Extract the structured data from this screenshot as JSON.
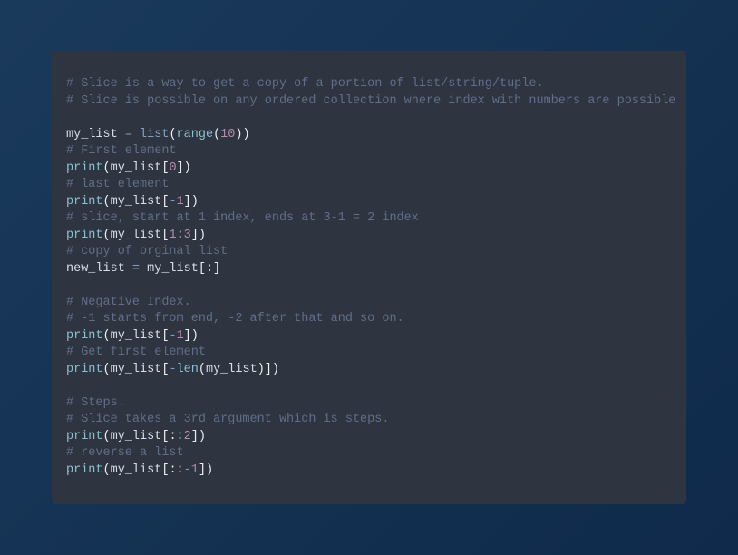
{
  "code": {
    "tokens": [
      [
        {
          "c": "comment",
          "t": "# Slice is a way to get a copy of a portion of list/string/tuple."
        }
      ],
      [
        {
          "c": "comment",
          "t": "# Slice is possible on any ordered collection where index with numbers are possible"
        }
      ],
      [],
      [
        {
          "c": "ident",
          "t": "my_list "
        },
        {
          "c": "operator",
          "t": "="
        },
        {
          "c": "ident",
          "t": " "
        },
        {
          "c": "builtin",
          "t": "list"
        },
        {
          "c": "punct",
          "t": "("
        },
        {
          "c": "func",
          "t": "range"
        },
        {
          "c": "punct",
          "t": "("
        },
        {
          "c": "number",
          "t": "10"
        },
        {
          "c": "punct",
          "t": "))"
        }
      ],
      [
        {
          "c": "comment",
          "t": "# First element"
        }
      ],
      [
        {
          "c": "func",
          "t": "print"
        },
        {
          "c": "punct",
          "t": "("
        },
        {
          "c": "ident",
          "t": "my_list"
        },
        {
          "c": "punct",
          "t": "["
        },
        {
          "c": "number",
          "t": "0"
        },
        {
          "c": "punct",
          "t": "])"
        }
      ],
      [
        {
          "c": "comment",
          "t": "# last element"
        }
      ],
      [
        {
          "c": "func",
          "t": "print"
        },
        {
          "c": "punct",
          "t": "("
        },
        {
          "c": "ident",
          "t": "my_list"
        },
        {
          "c": "punct",
          "t": "["
        },
        {
          "c": "operator",
          "t": "-"
        },
        {
          "c": "number",
          "t": "1"
        },
        {
          "c": "punct",
          "t": "])"
        }
      ],
      [
        {
          "c": "comment",
          "t": "# slice, start at 1 index, ends at 3-1 = 2 index"
        }
      ],
      [
        {
          "c": "func",
          "t": "print"
        },
        {
          "c": "punct",
          "t": "("
        },
        {
          "c": "ident",
          "t": "my_list"
        },
        {
          "c": "punct",
          "t": "["
        },
        {
          "c": "number",
          "t": "1"
        },
        {
          "c": "punct",
          "t": ":"
        },
        {
          "c": "number",
          "t": "3"
        },
        {
          "c": "punct",
          "t": "])"
        }
      ],
      [
        {
          "c": "comment",
          "t": "# copy of orginal list"
        }
      ],
      [
        {
          "c": "ident",
          "t": "new_list "
        },
        {
          "c": "operator",
          "t": "="
        },
        {
          "c": "ident",
          "t": " my_list"
        },
        {
          "c": "punct",
          "t": "[:]"
        }
      ],
      [],
      [
        {
          "c": "comment",
          "t": "# Negative Index."
        }
      ],
      [
        {
          "c": "comment",
          "t": "# -1 starts from end, -2 after that and so on."
        }
      ],
      [
        {
          "c": "func",
          "t": "print"
        },
        {
          "c": "punct",
          "t": "("
        },
        {
          "c": "ident",
          "t": "my_list"
        },
        {
          "c": "punct",
          "t": "["
        },
        {
          "c": "operator",
          "t": "-"
        },
        {
          "c": "number",
          "t": "1"
        },
        {
          "c": "punct",
          "t": "])"
        }
      ],
      [
        {
          "c": "comment",
          "t": "# Get first element"
        }
      ],
      [
        {
          "c": "func",
          "t": "print"
        },
        {
          "c": "punct",
          "t": "("
        },
        {
          "c": "ident",
          "t": "my_list"
        },
        {
          "c": "punct",
          "t": "["
        },
        {
          "c": "operator",
          "t": "-"
        },
        {
          "c": "func",
          "t": "len"
        },
        {
          "c": "punct",
          "t": "("
        },
        {
          "c": "ident",
          "t": "my_list"
        },
        {
          "c": "punct",
          "t": ")])"
        }
      ],
      [],
      [
        {
          "c": "comment",
          "t": "# Steps."
        }
      ],
      [
        {
          "c": "comment",
          "t": "# Slice takes a 3rd argument which is steps."
        }
      ],
      [
        {
          "c": "func",
          "t": "print"
        },
        {
          "c": "punct",
          "t": "("
        },
        {
          "c": "ident",
          "t": "my_list"
        },
        {
          "c": "punct",
          "t": "[::"
        },
        {
          "c": "number",
          "t": "2"
        },
        {
          "c": "punct",
          "t": "])"
        }
      ],
      [
        {
          "c": "comment",
          "t": "# reverse a list"
        }
      ],
      [
        {
          "c": "func",
          "t": "print"
        },
        {
          "c": "punct",
          "t": "("
        },
        {
          "c": "ident",
          "t": "my_list"
        },
        {
          "c": "punct",
          "t": "[::"
        },
        {
          "c": "operator",
          "t": "-"
        },
        {
          "c": "number",
          "t": "1"
        },
        {
          "c": "punct",
          "t": "])"
        }
      ]
    ]
  }
}
